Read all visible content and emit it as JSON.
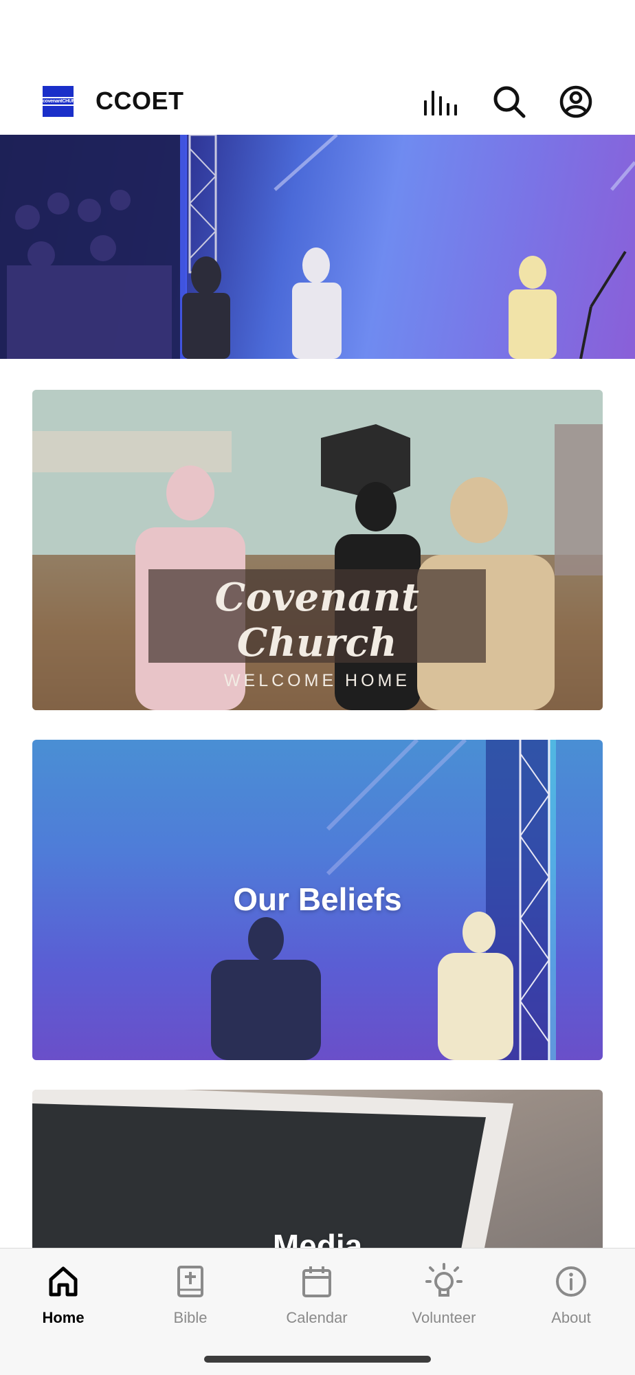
{
  "header": {
    "logo_text": "covenantCHURCH",
    "title": "CCOET",
    "icons": [
      "audio-bars-icon",
      "search-icon",
      "profile-icon"
    ]
  },
  "hero": {
    "description_icon": "worship-stage-photo"
  },
  "cards": [
    {
      "script_title": "Covenant Church",
      "subtitle": "WELCOME HOME"
    },
    {
      "title": "Our Beliefs"
    },
    {
      "title": "Media"
    }
  ],
  "bottom_nav": {
    "items": [
      {
        "label": "Home",
        "icon": "home-icon",
        "active": true
      },
      {
        "label": "Bible",
        "icon": "bible-icon",
        "active": false
      },
      {
        "label": "Calendar",
        "icon": "calendar-icon",
        "active": false
      },
      {
        "label": "Volunteer",
        "icon": "lightbulb-icon",
        "active": false
      },
      {
        "label": "About",
        "icon": "info-icon",
        "active": false
      }
    ]
  },
  "colors": {
    "accent": "#1a2fc9",
    "nav_active": "#000000",
    "nav_inactive": "#8a8a8a"
  }
}
